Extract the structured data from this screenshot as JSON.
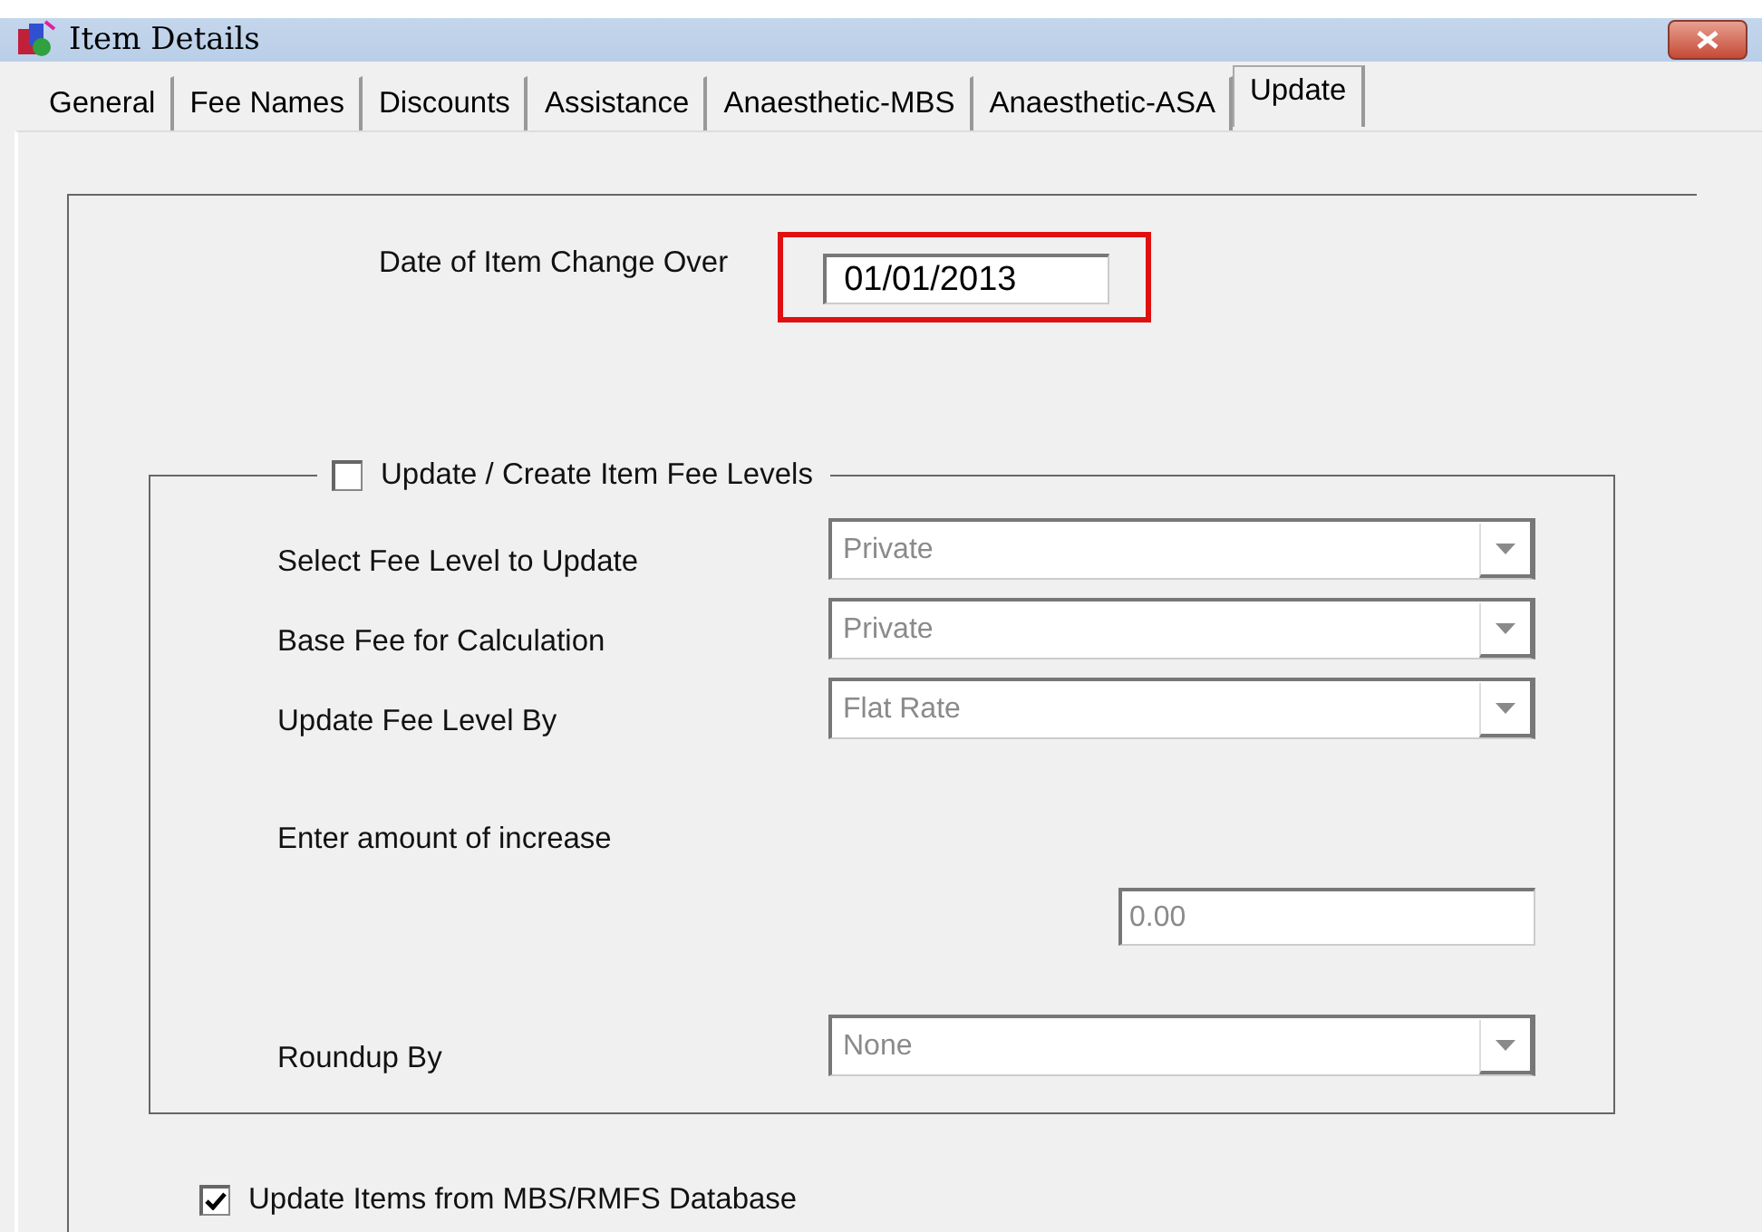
{
  "window": {
    "title": "Item Details"
  },
  "tabs": [
    {
      "label": "General",
      "selected": false
    },
    {
      "label": "Fee Names",
      "selected": false
    },
    {
      "label": "Discounts",
      "selected": false
    },
    {
      "label": "Assistance",
      "selected": false
    },
    {
      "label": "Anaesthetic-MBS",
      "selected": false
    },
    {
      "label": "Anaesthetic-ASA",
      "selected": false
    },
    {
      "label": "Update",
      "selected": true
    }
  ],
  "date_field": {
    "label": "Date of Item Change Over",
    "value": "01/01/2013",
    "highlighted": true
  },
  "fee_group": {
    "label": "Update / Create Item Fee Levels",
    "checked": false,
    "rows": [
      {
        "kind": "select",
        "label": "Select Fee Level to Update",
        "value": "Private",
        "disabled": true
      },
      {
        "kind": "select",
        "label": "Base Fee for Calculation",
        "value": "Private",
        "disabled": true
      },
      {
        "kind": "select",
        "label": "Update Fee Level By",
        "value": "Flat Rate",
        "disabled": true
      },
      {
        "kind": "input",
        "label": "Enter amount of increase",
        "value": "0.00",
        "disabled": true
      },
      {
        "kind": "select",
        "label": "Roundup By",
        "value": "None",
        "disabled": true
      }
    ]
  },
  "mbs_checkbox": {
    "label": "Update Items from MBS/RMFS Database",
    "checked": true
  }
}
